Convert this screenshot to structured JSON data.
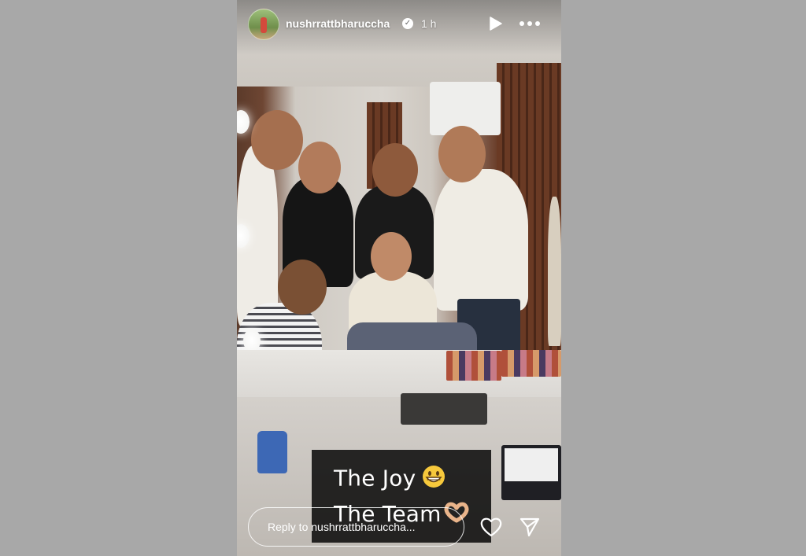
{
  "story": {
    "username": "nushrrattbharuccha",
    "verified": true,
    "time_ago": "1 h",
    "header_icons": {
      "play": "play-icon",
      "more": "more-horizontal-icon",
      "verified": "verified-badge-icon"
    },
    "caption": {
      "line1_text": "The Joy",
      "line1_emoji": "grinning-face-emoji",
      "line2_text": "The Team",
      "line2_emoji": "heart-hands-emoji"
    },
    "reply": {
      "placeholder": "Reply to nushrrattbharuccha..."
    },
    "footer_icons": {
      "like": "heart-icon",
      "share": "send-icon"
    }
  },
  "colors": {
    "page_background": "#a8a8a8",
    "caption_background": "#000000",
    "text": "#ffffff"
  }
}
